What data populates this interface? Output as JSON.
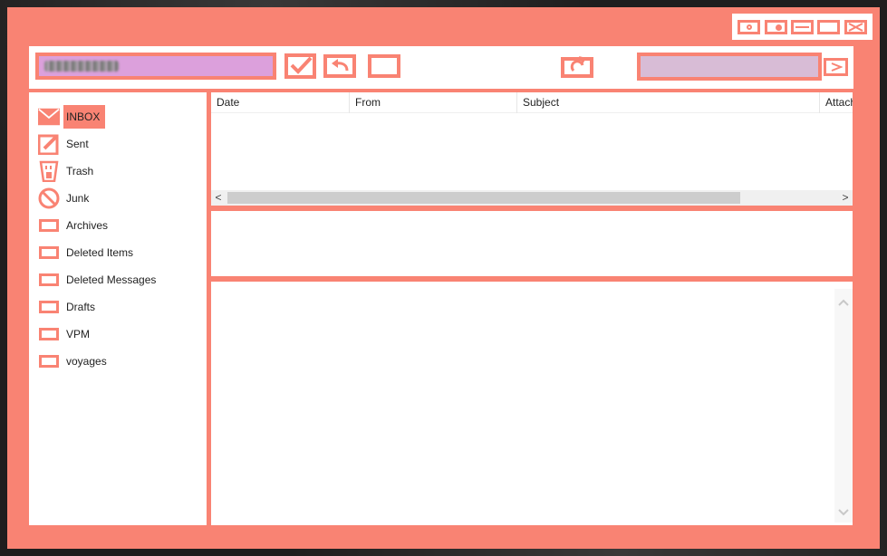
{
  "window": {
    "accent_color": "#f98373",
    "title_buttons": [
      {
        "name": "settings-icon"
      },
      {
        "name": "toggle-icon"
      },
      {
        "name": "minimize-icon"
      },
      {
        "name": "maximize-icon"
      },
      {
        "name": "close-icon"
      }
    ]
  },
  "toolbar": {
    "account_value": "",
    "search_placeholder": "",
    "icons": [
      "check-icon",
      "undo-icon",
      "blank-button-icon",
      "refresh-icon",
      "send-arrow-icon"
    ]
  },
  "folders": [
    {
      "label": "INBOX",
      "icon": "envelope-icon",
      "selected": true
    },
    {
      "label": "Sent",
      "icon": "pencil-icon"
    },
    {
      "label": "Trash",
      "icon": "trash-icon"
    },
    {
      "label": "Junk",
      "icon": "no-entry-icon"
    },
    {
      "label": "Archives",
      "icon": "folder-icon"
    },
    {
      "label": "Deleted Items",
      "icon": "folder-icon"
    },
    {
      "label": "Deleted Messages",
      "icon": "folder-icon"
    },
    {
      "label": "Drafts",
      "icon": "folder-icon"
    },
    {
      "label": "VPM",
      "icon": "folder-icon"
    },
    {
      "label": "voyages",
      "icon": "folder-icon"
    }
  ],
  "message_list": {
    "columns": [
      "Date",
      "From",
      "Subject",
      "Attach"
    ],
    "rows": []
  },
  "scroll": {
    "left_arrow": "<",
    "right_arrow": ">",
    "up_arrow": "^",
    "down_arrow": "v"
  }
}
